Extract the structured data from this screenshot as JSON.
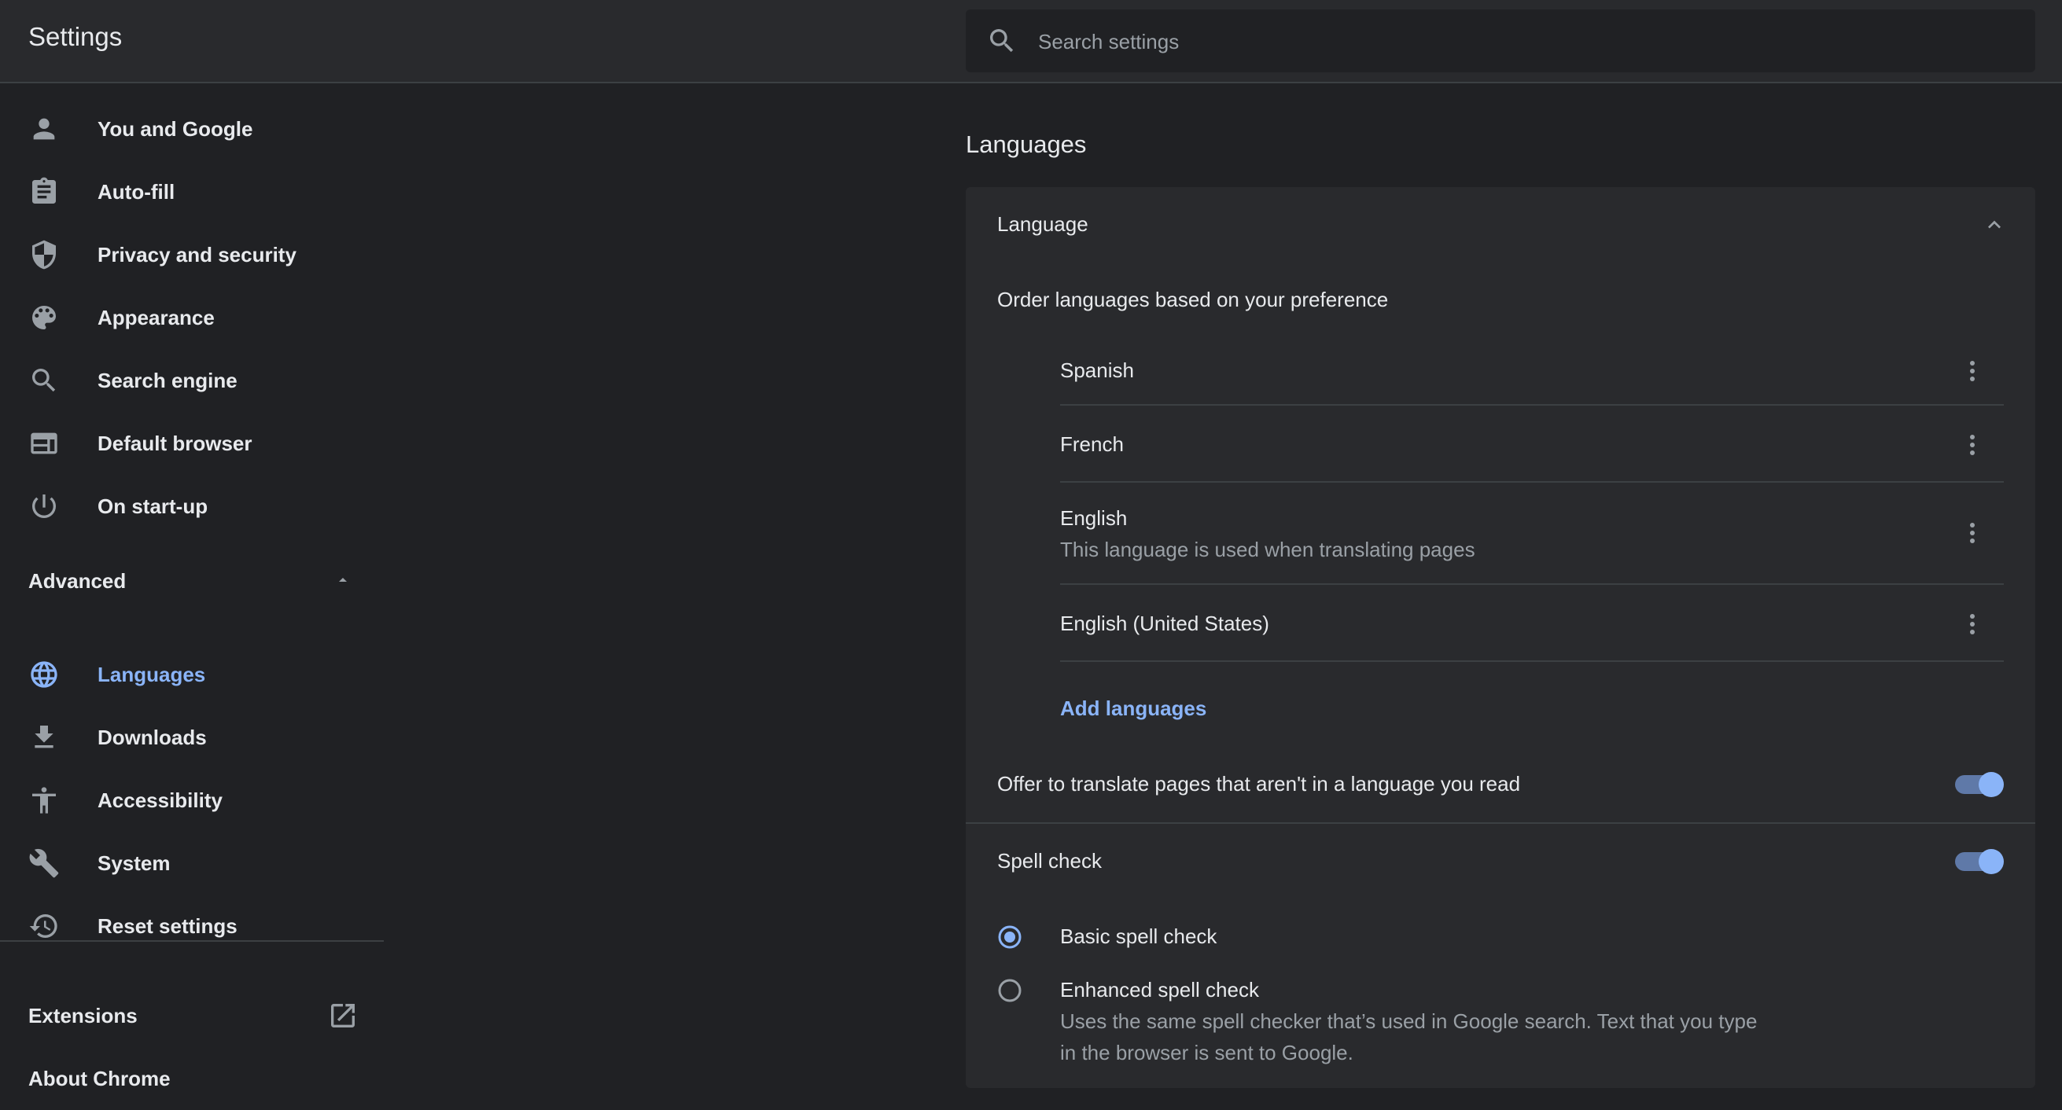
{
  "header": {
    "title": "Settings",
    "search_placeholder": "Search settings"
  },
  "sidebar": {
    "items": [
      {
        "label": "You and Google",
        "icon": "person-icon"
      },
      {
        "label": "Auto-fill",
        "icon": "clipboard-icon"
      },
      {
        "label": "Privacy and security",
        "icon": "shield-icon"
      },
      {
        "label": "Appearance",
        "icon": "palette-icon"
      },
      {
        "label": "Search engine",
        "icon": "search-icon"
      },
      {
        "label": "Default browser",
        "icon": "browser-icon"
      },
      {
        "label": "On start-up",
        "icon": "power-icon"
      }
    ],
    "advanced_label": "Advanced",
    "advanced_items": [
      {
        "label": "Languages",
        "icon": "globe-icon",
        "active": true
      },
      {
        "label": "Downloads",
        "icon": "download-icon"
      },
      {
        "label": "Accessibility",
        "icon": "accessibility-icon"
      },
      {
        "label": "System",
        "icon": "wrench-icon"
      },
      {
        "label": "Reset settings",
        "icon": "history-icon"
      }
    ],
    "extensions_label": "Extensions",
    "about_label": "About Chrome"
  },
  "main": {
    "page_title": "Languages",
    "language_section": {
      "heading": "Language",
      "order_label": "Order languages based on your preference",
      "languages": [
        {
          "name": "Spanish",
          "note": ""
        },
        {
          "name": "French",
          "note": ""
        },
        {
          "name": "English",
          "note": "This language is used when translating pages"
        },
        {
          "name": "English (United States)",
          "note": ""
        }
      ],
      "add_languages_label": "Add languages",
      "offer_translate_label": "Offer to translate pages that aren't in a language you read",
      "offer_translate_on": true
    },
    "spell_check": {
      "heading": "Spell check",
      "enabled": true,
      "options": [
        {
          "label": "Basic spell check",
          "selected": true
        },
        {
          "label": "Enhanced spell check",
          "selected": false,
          "description_line1": "Uses the same spell checker that’s used in Google search. Text that you type",
          "description_line2": "in the browser is sent to Google."
        }
      ]
    }
  },
  "colors": {
    "background": "#202124",
    "surface": "#292a2d",
    "accent": "#8ab4f8",
    "icon": "#9aa0a6"
  }
}
